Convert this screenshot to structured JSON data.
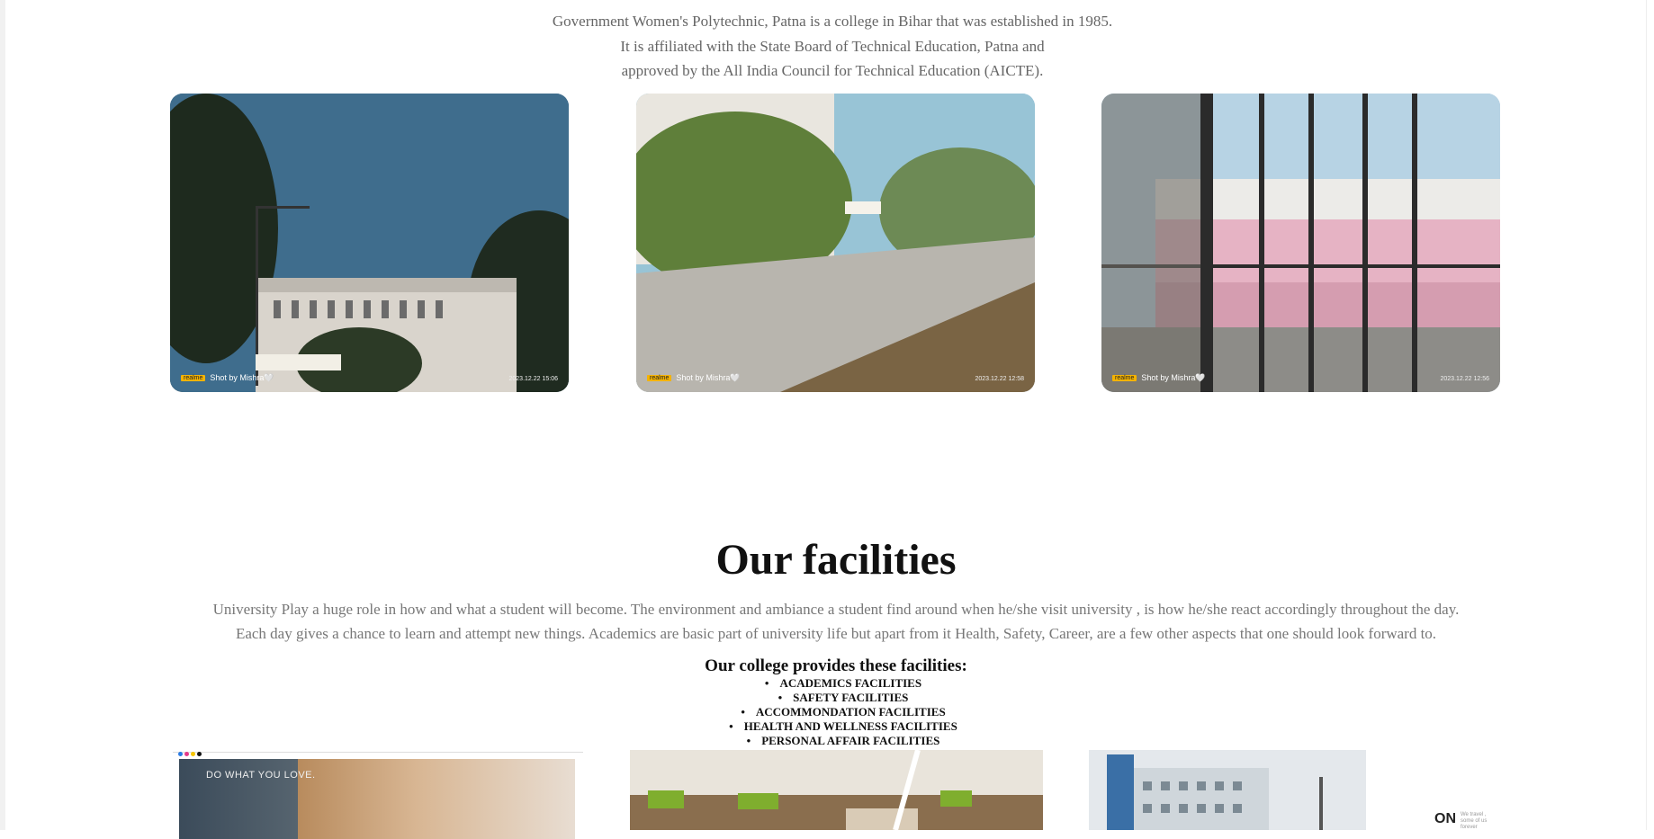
{
  "intro": {
    "line1": "Government Women's Polytechnic, Patna is a college in Bihar that was established in 1985.",
    "line2": "It is affiliated with the State Board of Technical Education, Patna and",
    "line3": "approved by the All India Council for Technical Education (AICTE)."
  },
  "photos": [
    {
      "brand": "realme",
      "credit": "Shot by Mishra🤍",
      "timestamp": "2023.12.22 15:06"
    },
    {
      "brand": "realme",
      "credit": "Shot by Mishra🤍",
      "timestamp": "2023.12.22 12:58"
    },
    {
      "brand": "realme",
      "credit": "Shot by Mishra🤍",
      "timestamp": "2023.12.22 12:56"
    }
  ],
  "facilities": {
    "title": "Our facilities",
    "desc_line1": "University Play a huge role in how and what a student will become. The environment and ambiance a student find around when he/she visit university , is how he/she react accordingly throughout the day.",
    "desc_line2": "Each day gives a chance to learn and attempt new things. Academics are basic part of university life but apart from it Health, Safety, Career, are a few other aspects that one should look forward to.",
    "provides_title": "Our college provides these facilities:",
    "items": [
      "ACADEMICS FACILITIES",
      "SAFETY FACILITIES",
      "ACCOMMONDATION FACILITIES",
      "HEALTH AND WELLNESS FACILITIES",
      "PERSONAL AFFAIR FACILITIES"
    ]
  },
  "bottom_images": {
    "caption1": "DO WHAT YOU LOVE.",
    "on_badge": "ON",
    "on_sub": "We travel , some of us forever"
  }
}
